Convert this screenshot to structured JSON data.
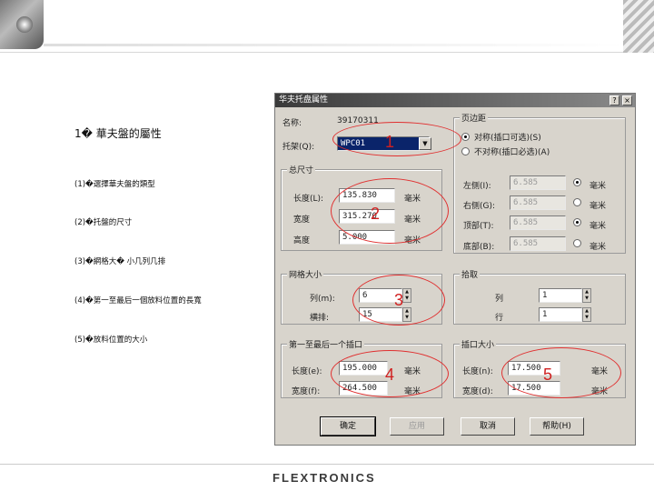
{
  "notes": {
    "heading": "1� 華夫盤的屬性",
    "items": [
      "(1)�選擇華夫盤的類型",
      "(2)�托盤的尺寸",
      "(3)�網格大� 小几列几排",
      "(4)�第一至最后一個放料位置的長寬",
      "(5)�放料位置的大小"
    ]
  },
  "dialog": {
    "title": "华夫托盘属性",
    "help_btn": "?",
    "close_btn": "×",
    "name_label": "名称:",
    "name_value": "39170311",
    "tray_label": "托架(Q):",
    "tray_value": "WPC01",
    "edge": {
      "title": "页边距",
      "opt_symmetric": "对称(插口可选)(S)",
      "opt_asymmetric": "不对称(插口必选)(A)",
      "left_label": "左侧(I):",
      "left_value": "6.585",
      "left_unit": "毫米",
      "right_label": "右侧(G):",
      "right_value": "6.585",
      "right_unit": "毫米",
      "top_label": "顶部(T):",
      "top_value": "6.585",
      "top_unit": "毫米",
      "bottom_label": "底部(B):",
      "bottom_value": "6.585",
      "bottom_unit": "毫米"
    },
    "size": {
      "title": "总尺寸",
      "length_label": "长度(L):",
      "length_value": "135.830",
      "length_unit": "毫米",
      "width_label": "宽度",
      "width_value": "315.270",
      "width_unit": "毫米",
      "height_label": "高度",
      "height_value": "5.000",
      "height_unit": "毫米"
    },
    "grid": {
      "title": "网格大小",
      "cols_label": "列(m):",
      "cols_value": "6",
      "rows_label": "横排:",
      "rows_value": "15"
    },
    "pick": {
      "title": "拾取",
      "col_label": "列",
      "col_value": "1",
      "row_label": "行",
      "row_value": "1"
    },
    "first_last": {
      "title": "第一至最后一个插口",
      "length_label": "长度(e):",
      "length_value": "195.000",
      "length_unit": "毫米",
      "width_label": "宽度(f):",
      "width_value": "264.500",
      "width_unit": "毫米"
    },
    "pocket": {
      "title": "插口大小",
      "length_label": "长度(n):",
      "length_value": "17.500",
      "length_unit": "毫米",
      "width_label": "宽度(d):",
      "width_value": "17.500",
      "width_unit": "毫米"
    },
    "buttons": {
      "ok": "确定",
      "apply": "应用",
      "cancel": "取消",
      "help": "帮助(H)"
    }
  },
  "callouts": [
    "1",
    "2",
    "3",
    "4",
    "5"
  ],
  "footer": {
    "logo": "FLEXTRONICS"
  },
  "colors": {
    "callout": "#d02020",
    "dialog_bg": "#d8d4cc"
  }
}
